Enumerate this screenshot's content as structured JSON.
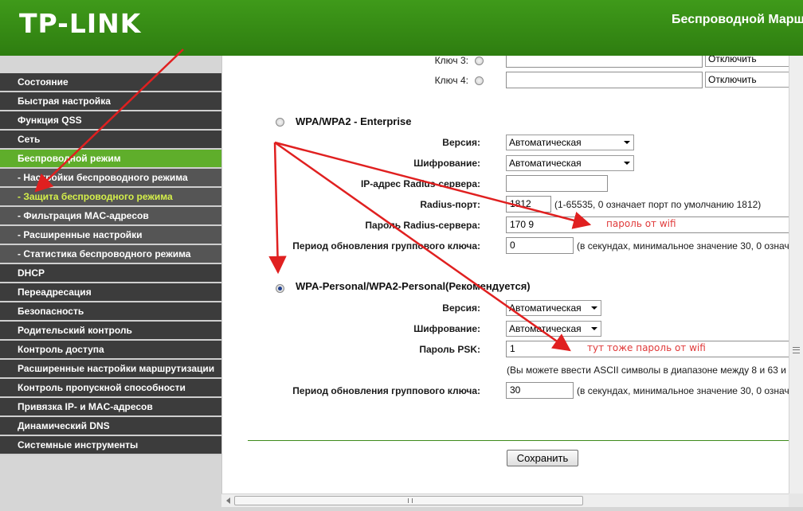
{
  "header": {
    "logo": "TP-LINK",
    "title": "Беспроводной Марш"
  },
  "sidebar": {
    "items": [
      {
        "label": "Состояние",
        "type": "main"
      },
      {
        "label": "Быстрая настройка",
        "type": "main"
      },
      {
        "label": "Функция QSS",
        "type": "main"
      },
      {
        "label": "Сеть",
        "type": "main"
      },
      {
        "label": "Беспроводной режим",
        "type": "active"
      },
      {
        "label": "- Настройки беспроводного режима",
        "type": "sub"
      },
      {
        "label": "- Защита беспроводного режима",
        "type": "sub-active"
      },
      {
        "label": "- Фильтрация MAC-адресов",
        "type": "sub"
      },
      {
        "label": "- Расширенные настройки",
        "type": "sub"
      },
      {
        "label": "- Статистика беспроводного режима",
        "type": "sub"
      },
      {
        "label": "DHCP",
        "type": "main"
      },
      {
        "label": "Переадресация",
        "type": "main"
      },
      {
        "label": "Безопасность",
        "type": "main"
      },
      {
        "label": "Родительский контроль",
        "type": "main"
      },
      {
        "label": "Контроль доступа",
        "type": "main"
      },
      {
        "label": "Расширенные настройки маршрутизации",
        "type": "main"
      },
      {
        "label": "Контроль пропускной способности",
        "type": "main"
      },
      {
        "label": "Привязка IP- и MAC-адресов",
        "type": "main"
      },
      {
        "label": "Динамический DNS",
        "type": "main"
      },
      {
        "label": "Системные инструменты",
        "type": "main"
      }
    ]
  },
  "wep_keys": {
    "key3_label": "Ключ 3:",
    "key3_select": "Отключить",
    "key4_label": "Ключ 4:",
    "key4_select": "Отключить"
  },
  "enterprise": {
    "title": "WPA/WPA2 - Enterprise",
    "version_label": "Версия:",
    "version_value": "Автоматическая",
    "encryption_label": "Шифрование:",
    "encryption_value": "Автоматическая",
    "radius_ip_label": "IP-адрес Radius-сервера:",
    "radius_ip_value": "",
    "radius_port_label": "Radius-порт:",
    "radius_port_value": "1812",
    "radius_port_hint": "(1-65535, 0 означает порт по умолчанию 1812)",
    "radius_password_label": "Пароль Radius-сервера:",
    "radius_password_value": "170   9",
    "group_key_label": "Период обновления группового ключа:",
    "group_key_value": "0",
    "group_key_hint": "(в секундах, минимальное значение 30, 0 означ"
  },
  "personal": {
    "title": "WPA-Personal/WPA2-Personal(Рекомендуется)",
    "version_label": "Версия:",
    "version_value": "Автоматическая",
    "encryption_label": "Шифрование:",
    "encryption_value": "Автоматическая",
    "psk_label": "Пароль PSK:",
    "psk_value": "1",
    "psk_hint": "(Вы можете ввести ASCII символы в диапазоне между 8 и 63 и",
    "group_key_label": "Период обновления группового ключа:",
    "group_key_value": "30",
    "group_key_hint": "(в секундах, минимальное значение 30, 0 означ"
  },
  "annotations": {
    "note1": "пароль от wifi",
    "note2": "тут тоже пароль от wifi",
    "color": "#e02020"
  },
  "save_label": "Сохранить",
  "colors": {
    "header_green": "#3a9317",
    "nav_dark": "#3c3c3c",
    "nav_active": "#5fae2b",
    "sub_active_text": "#d5f04a"
  }
}
